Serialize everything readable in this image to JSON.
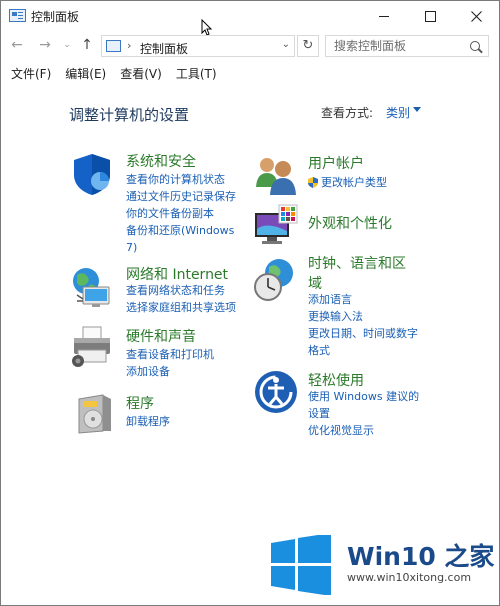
{
  "window": {
    "title": "控制面板"
  },
  "address": {
    "path": "控制面板"
  },
  "search": {
    "placeholder": "搜索控制面板"
  },
  "menu": [
    "文件(F)",
    "编辑(E)",
    "查看(V)",
    "工具(T)"
  ],
  "main": {
    "heading": "调整计算机的设置",
    "view_by_label": "查看方式:",
    "view_by_value": "类别"
  },
  "categories": {
    "system": {
      "title": "系统和安全",
      "links": [
        "查看你的计算机状态",
        "通过文件历史记录保存",
        "你的文件备份副本",
        "备份和还原(Windows",
        "7)"
      ],
      "icon": "shield-icon"
    },
    "network": {
      "title": "网络和 Internet",
      "links": [
        "查看网络状态和任务",
        "选择家庭组和共享选项"
      ],
      "icon": "network-globe-icon"
    },
    "hardware": {
      "title": "硬件和声音",
      "links": [
        "查看设备和打印机",
        "添加设备"
      ],
      "icon": "printer-icon"
    },
    "programs": {
      "title": "程序",
      "links": [
        "卸载程序"
      ],
      "icon": "programs-box-icon"
    },
    "users": {
      "title": "用户帐户",
      "links": [
        "更改帐户类型"
      ],
      "icon": "users-icon"
    },
    "appearance": {
      "title": "外观和个性化",
      "links": [],
      "icon": "monitor-palette-icon"
    },
    "clock": {
      "title": "时钟、语言和区",
      "title2": "域",
      "links": [
        "添加语言",
        "更换输入法",
        "更改日期、时间或数字",
        "格式"
      ],
      "icon": "clock-globe-icon"
    },
    "ease": {
      "title": "轻松使用",
      "links": [
        "使用 Windows 建议的",
        "设置",
        "优化视觉显示"
      ],
      "icon": "ease-of-access-icon"
    }
  },
  "watermark": {
    "brand": "Win10 之家",
    "url": "www.win10xitong.com"
  },
  "colors": {
    "link": "#1a5fb4",
    "category_title": "#2a7a2a",
    "watermark_blue": "#1a8fe0"
  }
}
